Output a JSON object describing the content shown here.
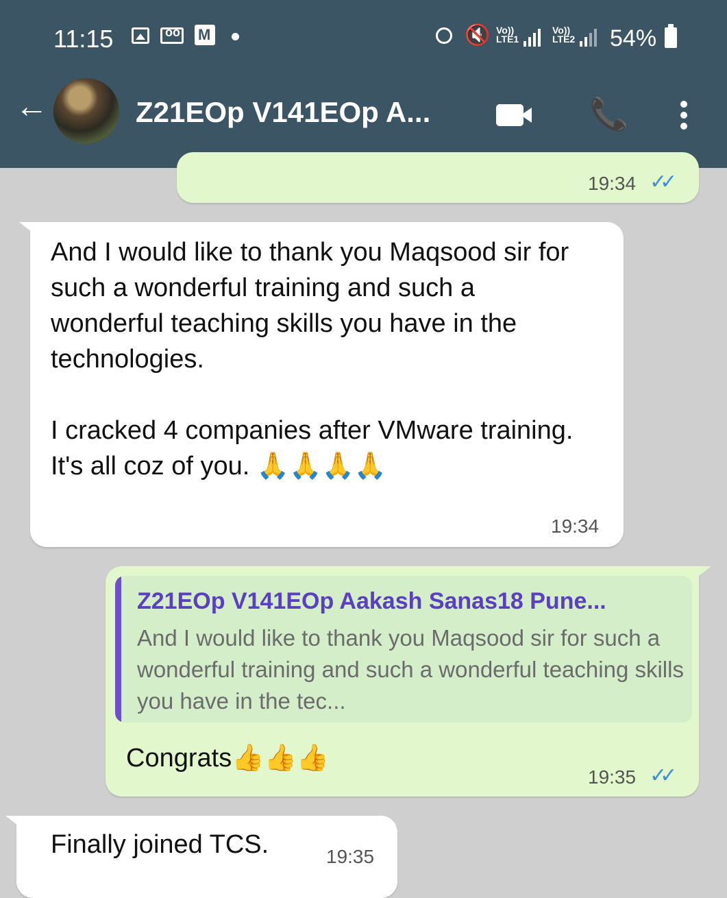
{
  "status_bar": {
    "time": "11:15",
    "icons": [
      "gallery-icon",
      "voicemail-icon",
      "mail-icon",
      "dot-icon",
      "alarm-icon",
      "mute-icon",
      "lte1-signal",
      "lte2-signal",
      "battery-icon"
    ],
    "lte1_label": "Vo))\nLTE1",
    "lte2_label": "Vo))\nLTE2",
    "battery": "54%"
  },
  "header": {
    "contact_name": "Z21EOp V141EOp A...",
    "colors": {
      "bar": "#3c5565",
      "background": "#cfcfcf",
      "incoming": "#ffffff",
      "outgoing": "#e2f7cb",
      "read_ticks": "#3a8fe0",
      "quote_accent": "#6f4fc9"
    }
  },
  "messages": [
    {
      "id": "m0",
      "direction": "out",
      "time": "19:34",
      "status": "read"
    },
    {
      "id": "m1",
      "direction": "in",
      "text": "And I would like to thank you Maqsood sir for such a wonderful training and such a wonderful teaching skills you have in the technologies.\n\nI cracked 4 companies after VMware training. It's all coz of you. 🙏🙏🙏🙏",
      "time": "19:34"
    },
    {
      "id": "m2",
      "direction": "out",
      "quote_author": "Z21EOp V141EOp Aakash Sanas18 Pune...",
      "quote_text": "And I would like to thank you Maqsood sir for such a wonderful training and such a wonderful teaching skills you have in the tec...",
      "text": "Congrats👍👍👍",
      "time": "19:35",
      "status": "read"
    },
    {
      "id": "m3",
      "direction": "in",
      "text": "Finally joined TCS.",
      "time": "19:35"
    }
  ]
}
